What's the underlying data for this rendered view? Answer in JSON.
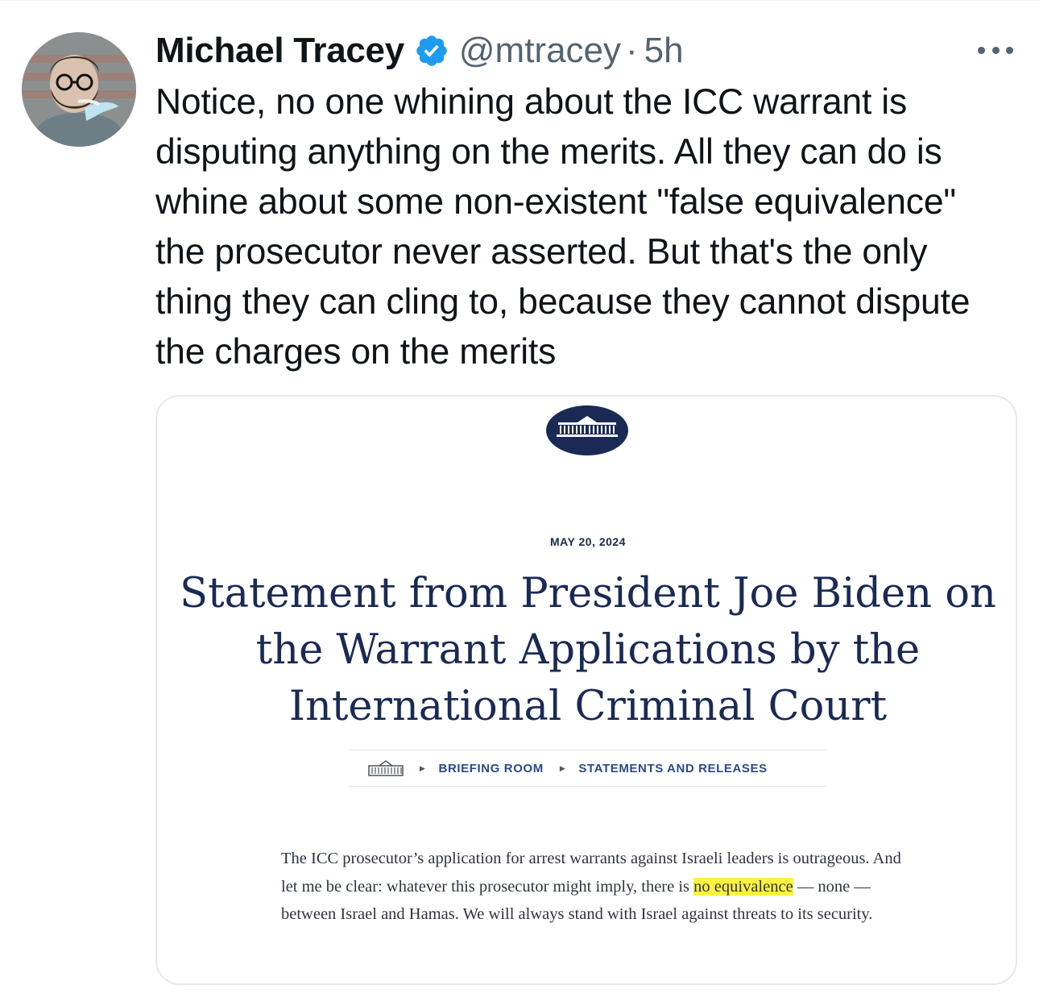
{
  "author": {
    "display_name": "Michael Tracey",
    "handle": "@mtracey",
    "separator": "·",
    "time": "5h"
  },
  "tweet": {
    "text": "Notice, no one whining about the ICC warrant is disputing anything on the merits. All they can do is whine about some non-existent \"false equivalence\" the prosecutor never asserted. But that's the only thing they can cling to, because they cannot dispute the charges on the merits"
  },
  "media": {
    "date": "MAY 20, 2024",
    "title": "Statement from President Joe Biden on the Warrant Applications by the International Criminal Court",
    "breadcrumb": [
      "BRIEFING ROOM",
      "STATEMENTS AND RELEASES"
    ],
    "body_before": "The ICC prosecutor’s application for arrest warrants against Israeli leaders is outrageous. And let me be clear: whatever this prosecutor might imply, there is ",
    "body_highlight": "no equivalence",
    "body_after": " — none — between Israel and Hamas.  We will always stand with Israel against threats to its security."
  },
  "colors": {
    "text": "#0f1419",
    "secondary": "#536471",
    "verified": "#1d9bf0",
    "wh_navy": "#1a2a55",
    "highlight": "#fdf23f"
  },
  "icons": {
    "verified": "verified-badge-icon",
    "more": "more-horizontal-icon",
    "logo": "white-house-logo",
    "home": "white-house-home-icon"
  }
}
